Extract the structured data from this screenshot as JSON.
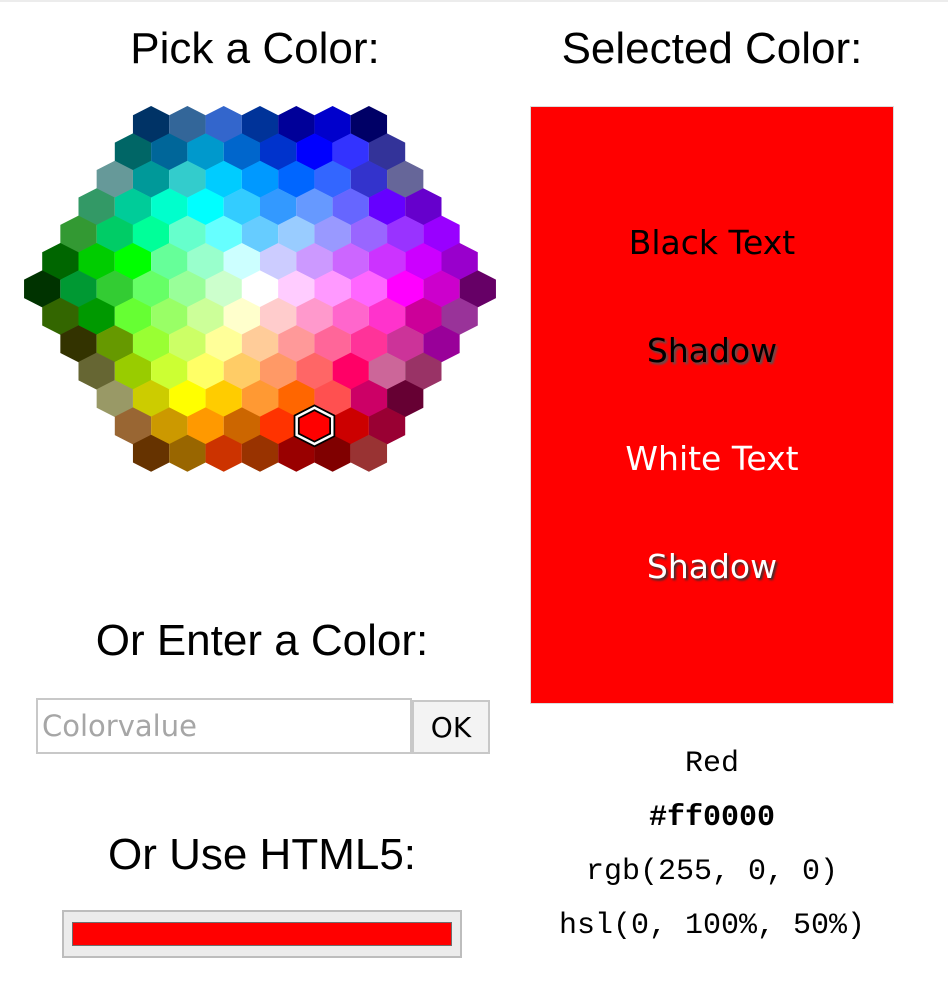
{
  "picker": {
    "title": "Pick a Color:",
    "selected_hex": "#ff0000",
    "rows": [
      [
        "#003366",
        "#336699",
        "#3366cc",
        "#003399",
        "#000099",
        "#0000cc",
        "#000066"
      ],
      [
        "#006666",
        "#006699",
        "#0099cc",
        "#0066cc",
        "#0033cc",
        "#0000ff",
        "#3333ff",
        "#333399"
      ],
      [
        "#669999",
        "#009999",
        "#33cccc",
        "#00ccff",
        "#0099ff",
        "#0066ff",
        "#3366ff",
        "#3333cc",
        "#666699"
      ],
      [
        "#339966",
        "#00cc99",
        "#00ffcc",
        "#00ffff",
        "#33ccff",
        "#3399ff",
        "#6699ff",
        "#6666ff",
        "#6600ff",
        "#6600cc"
      ],
      [
        "#339933",
        "#00cc66",
        "#00ff99",
        "#66ffcc",
        "#66ffff",
        "#66ccff",
        "#99ccff",
        "#9999ff",
        "#9966ff",
        "#9933ff",
        "#9900ff"
      ],
      [
        "#006600",
        "#00cc00",
        "#00ff00",
        "#66ff99",
        "#99ffcc",
        "#ccffff",
        "#ccccff",
        "#cc99ff",
        "#cc66ff",
        "#cc33ff",
        "#cc00ff",
        "#9900cc"
      ],
      [
        "#003300",
        "#009933",
        "#33cc33",
        "#66ff66",
        "#99ff99",
        "#ccffcc",
        "#ffffff",
        "#ffccff",
        "#ff99ff",
        "#ff66ff",
        "#ff00ff",
        "#cc00cc",
        "#660066"
      ],
      [
        "#336600",
        "#009900",
        "#66ff33",
        "#99ff66",
        "#ccff99",
        "#ffffcc",
        "#ffcccc",
        "#ff99cc",
        "#ff66cc",
        "#ff33cc",
        "#cc0099",
        "#993399"
      ],
      [
        "#333300",
        "#669900",
        "#99ff33",
        "#ccff66",
        "#ffff99",
        "#ffcc99",
        "#ff9999",
        "#ff6699",
        "#ff3399",
        "#cc3399",
        "#990099"
      ],
      [
        "#666633",
        "#99cc00",
        "#ccff33",
        "#ffff66",
        "#ffcc66",
        "#ff9966",
        "#ff6666",
        "#ff0066",
        "#cc6699",
        "#993366"
      ],
      [
        "#999966",
        "#cccc00",
        "#ffff00",
        "#ffcc00",
        "#ff9933",
        "#ff6600",
        "#ff5050",
        "#cc0066",
        "#660033"
      ],
      [
        "#996633",
        "#cc9900",
        "#ff9900",
        "#cc6600",
        "#ff3300",
        "#ff0000",
        "#cc0000",
        "#990033"
      ],
      [
        "#663300",
        "#996600",
        "#cc3300",
        "#993300",
        "#990000",
        "#800000",
        "#993333"
      ]
    ]
  },
  "selected": {
    "title": "Selected Color:",
    "color": "#ff0000",
    "black_text": "Black Text",
    "shadow_text_1": "Shadow",
    "white_text": "White Text",
    "shadow_text_2": "Shadow",
    "name": "Red",
    "hex": "#ff0000",
    "rgb": "rgb(255, 0, 0)",
    "hsl": "hsl(0, 100%, 50%)"
  },
  "enter": {
    "title": "Or Enter a Color:",
    "placeholder": "Colorvalue",
    "value": "",
    "ok_label": "OK"
  },
  "html5": {
    "title": "Or Use HTML5:",
    "value": "#ff0000"
  }
}
